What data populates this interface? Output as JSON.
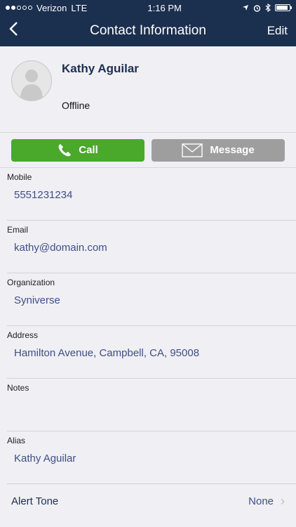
{
  "status_bar": {
    "carrier": "Verizon",
    "network": "LTE",
    "time": "1:16 PM"
  },
  "nav": {
    "title": "Contact Information",
    "edit_label": "Edit",
    "back_icon": "chevron-left-icon"
  },
  "contact": {
    "name": "Kathy Aguilar",
    "status": "Offline"
  },
  "actions": {
    "call_label": "Call",
    "message_label": "Message"
  },
  "fields": [
    {
      "label": "Mobile",
      "value": "5551231234"
    },
    {
      "label": "Email",
      "value": "kathy@domain.com"
    },
    {
      "label": "Organization",
      "value": "Syniverse"
    },
    {
      "label": "Address",
      "value": "Hamilton Avenue, Campbell, CA, 95008"
    },
    {
      "label": "Notes",
      "value": ""
    },
    {
      "label": "Alias",
      "value": "Kathy Aguilar"
    }
  ],
  "alert_tone": {
    "label": "Alert Tone",
    "value": "None"
  },
  "colors": {
    "nav_background": "#1b2f4f",
    "call_button": "#4aa82b",
    "message_button": "#9e9e9e",
    "value_text": "#3f4f86"
  }
}
